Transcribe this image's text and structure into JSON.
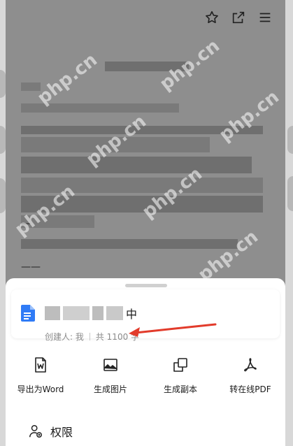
{
  "toolbar": {
    "icons": [
      "star-icon",
      "open-external-icon",
      "menu-icon"
    ]
  },
  "document": {
    "dash_mark": "—",
    "double_dash": "——"
  },
  "watermark_text": "php.cn",
  "sheet": {
    "file": {
      "title_suffix": "中",
      "creator": "创建人: 我",
      "word_count": "共 1100 字"
    },
    "actions": [
      {
        "label": "导出为Word",
        "icon": "word-doc-icon"
      },
      {
        "label": "生成图片",
        "icon": "image-icon"
      },
      {
        "label": "生成副本",
        "icon": "copy-icon"
      },
      {
        "label": "转在线PDF",
        "icon": "pdf-icon"
      }
    ],
    "permission": {
      "label": "权限",
      "icon": "user-permission-icon"
    }
  },
  "colors": {
    "overlay": "#8e8e8e",
    "doc_blue": "#2f7bf6",
    "arrow_red": "#e23b2b"
  }
}
